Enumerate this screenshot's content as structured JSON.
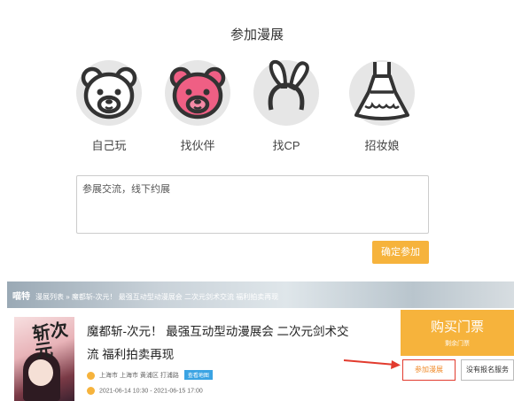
{
  "section_title": "参加漫展",
  "options": [
    {
      "label": "自己玩",
      "icon": "bear-face-icon",
      "highlight": false
    },
    {
      "label": "找伙伴",
      "icon": "bear-face-icon",
      "highlight": true
    },
    {
      "label": "找CP",
      "icon": "bunny-ears-headband-icon",
      "highlight": false
    },
    {
      "label": "招妆娘",
      "icon": "dress-icon",
      "highlight": false
    }
  ],
  "message": {
    "value": "参展交流，线下约展"
  },
  "confirm_label": "确定参加",
  "colors": {
    "accent": "#f6b33c",
    "highlight": "#ef5f84",
    "icon_bg": "#e6e6e6",
    "arrow": "#e23b2e"
  },
  "event": {
    "breadcrumb_brand": "喵特",
    "breadcrumb": "漫展列表 » 魔都斩-次元！ 最强互动型动漫展会 二次元剑术交流 福利拍卖再现",
    "poster_text": "斩次元",
    "title": "魔都斩-次元！ 最强互动型动漫展会 二次元剑术交流 福利拍卖再现",
    "address": "上海市 上海市 黄浦区 打浦路",
    "map_label": "查看地图",
    "time": "2021-06-14 10:30 - 2021-06-15 17:00",
    "buy_label": "购买门票",
    "buy_sub": "剩余门票",
    "join_label": "参加漫展",
    "service_label": "没有报名服务",
    "footnote": ""
  }
}
